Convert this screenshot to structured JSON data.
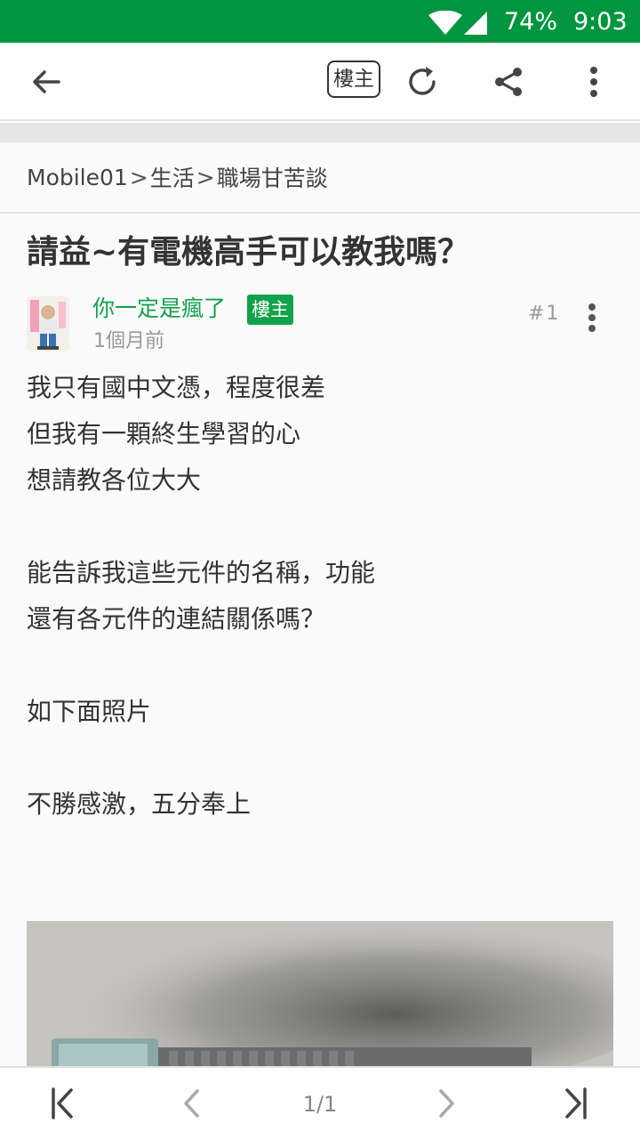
{
  "status_bar": {
    "battery": "74%",
    "time": "9:03",
    "icons": [
      "wifi-icon",
      "signal-icon"
    ]
  },
  "app_bar": {
    "op_filter_label": "樓主",
    "icons": [
      "back-arrow-icon",
      "refresh-icon",
      "share-icon",
      "more-vert-icon"
    ]
  },
  "breadcrumb": {
    "items": [
      "Mobile01",
      "生活",
      "職場甘苦談"
    ],
    "separator": ">"
  },
  "post": {
    "title": "請益~有電機高手可以教我嗎？",
    "author": "你一定是瘋了",
    "author_badge": "樓主",
    "time": "1個月前",
    "floor": "#1",
    "body_lines": [
      "我只有國中文憑，程度很差",
      "但我有一顆終生學習的心",
      "想請教各位大大",
      "",
      "能告訴我這些元件的名稱，功能",
      "還有各元件的連結關係嗎？",
      "",
      "如下面照片",
      "",
      "不勝感激，五分奉上"
    ]
  },
  "pager": {
    "indicator": "1/1",
    "icons": [
      "first-page-icon",
      "prev-page-icon",
      "next-page-icon",
      "last-page-icon"
    ]
  },
  "colors": {
    "status_bar": "#00963f",
    "accent_green": "#12a24b",
    "text": "#333333",
    "muted": "#999999"
  }
}
